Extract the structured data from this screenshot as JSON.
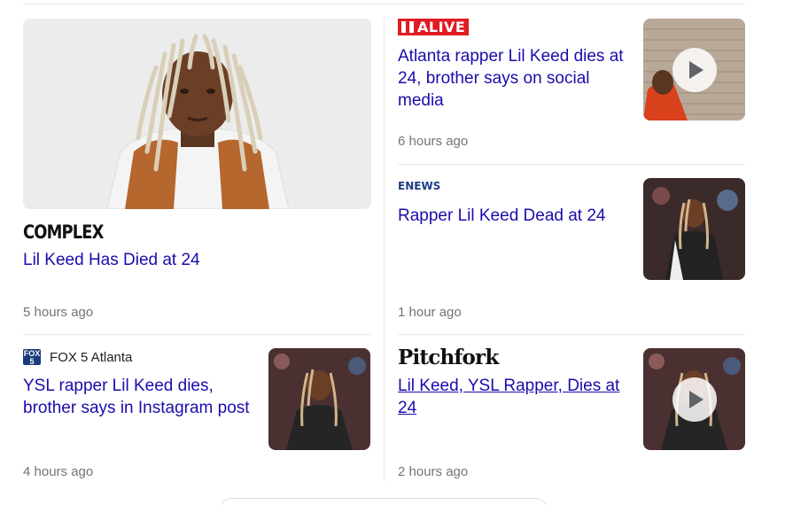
{
  "articles": [
    {
      "source": "COMPLEX",
      "headline": "Lil Keed Has Died at 24",
      "time": "5 hours ago"
    },
    {
      "source": "ALIVE",
      "headline": "Atlanta rapper Lil Keed dies at 24, brother says on social media",
      "time": "6 hours ago",
      "video": true
    },
    {
      "source": "ENEWS",
      "headline": "Rapper Lil Keed Dead at 24",
      "time": "1 hour ago"
    },
    {
      "source": "FOX 5 Atlanta",
      "source_logo": "FOX 5",
      "headline": "YSL rapper Lil Keed dies, brother says in Instagram post",
      "time": "4 hours ago"
    },
    {
      "source": "Pitchfork",
      "headline": "Lil Keed, YSL Rapper, Dies at 24",
      "time": "2 hours ago",
      "video": true
    }
  ],
  "colors": {
    "link": "#1a0dab",
    "meta": "#70757a",
    "divider": "#e8eaed"
  }
}
